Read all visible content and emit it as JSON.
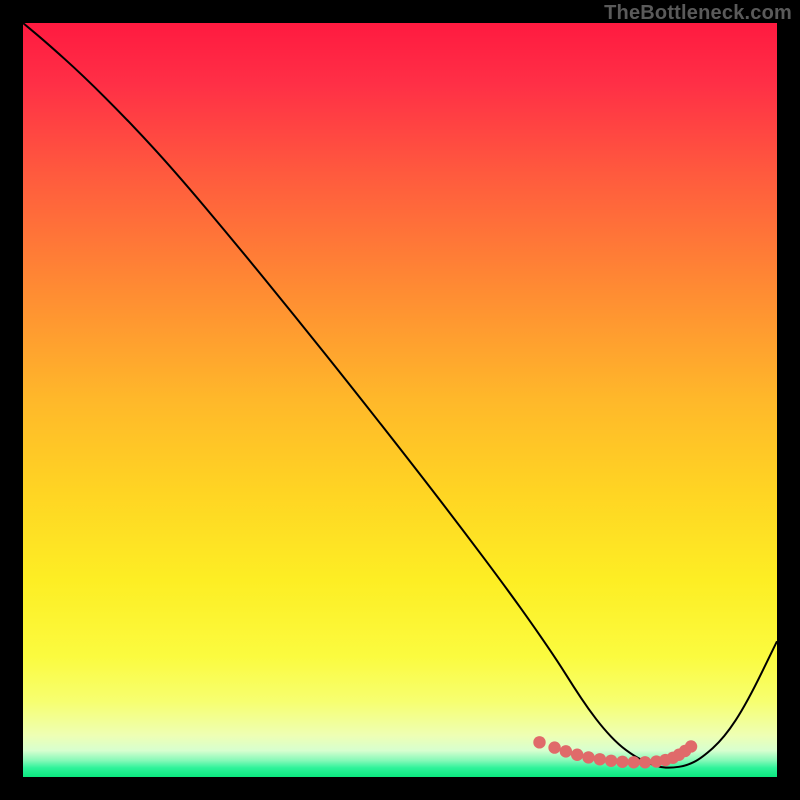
{
  "watermark": "TheBottleneck.com",
  "colors": {
    "background": "#000000",
    "gradient_stops": [
      {
        "offset": 0.0,
        "color": "#ff1a40"
      },
      {
        "offset": 0.08,
        "color": "#ff2f46"
      },
      {
        "offset": 0.2,
        "color": "#ff5a3e"
      },
      {
        "offset": 0.35,
        "color": "#ff8a33"
      },
      {
        "offset": 0.5,
        "color": "#ffb82a"
      },
      {
        "offset": 0.62,
        "color": "#ffd423"
      },
      {
        "offset": 0.74,
        "color": "#fdee24"
      },
      {
        "offset": 0.84,
        "color": "#fbfb3f"
      },
      {
        "offset": 0.9,
        "color": "#f7ff70"
      },
      {
        "offset": 0.945,
        "color": "#eeffb4"
      },
      {
        "offset": 0.965,
        "color": "#d7ffcf"
      },
      {
        "offset": 0.978,
        "color": "#86f9b8"
      },
      {
        "offset": 0.988,
        "color": "#2ef39a"
      },
      {
        "offset": 1.0,
        "color": "#0be77e"
      }
    ],
    "curve": "#000000",
    "marker_fill": "#e06a6a",
    "marker_stroke": "#c74e4e"
  },
  "chart_data": {
    "type": "line",
    "title": "",
    "xlabel": "",
    "ylabel": "",
    "xlim": [
      0,
      100
    ],
    "ylim": [
      0,
      100
    ],
    "grid": false,
    "legend": false,
    "series": [
      {
        "name": "bottleneck-curve",
        "x": [
          0,
          3,
          8,
          14,
          20,
          28,
          36,
          44,
          52,
          58,
          64,
          68,
          71,
          73,
          75,
          77,
          79,
          81,
          83,
          84.5,
          86,
          88,
          90,
          93,
          96,
          100
        ],
        "y": [
          100,
          97.5,
          93,
          87,
          80.5,
          71,
          61.2,
          51.2,
          41,
          33.2,
          25.2,
          19.6,
          15.2,
          12,
          9,
          6.4,
          4.3,
          2.8,
          1.8,
          1.3,
          1.2,
          1.5,
          2.5,
          5.2,
          9.8,
          18
        ]
      }
    ],
    "markers": {
      "name": "optimal-range",
      "x": [
        68.5,
        70.5,
        72,
        73.5,
        75,
        76.5,
        78,
        79.5,
        81,
        82.5,
        84,
        85.2,
        86.2,
        87,
        87.8,
        88.6
      ],
      "y": [
        4.6,
        3.9,
        3.4,
        2.95,
        2.6,
        2.35,
        2.15,
        2.02,
        1.95,
        1.95,
        2.05,
        2.25,
        2.55,
        2.95,
        3.45,
        4.05
      ]
    }
  }
}
